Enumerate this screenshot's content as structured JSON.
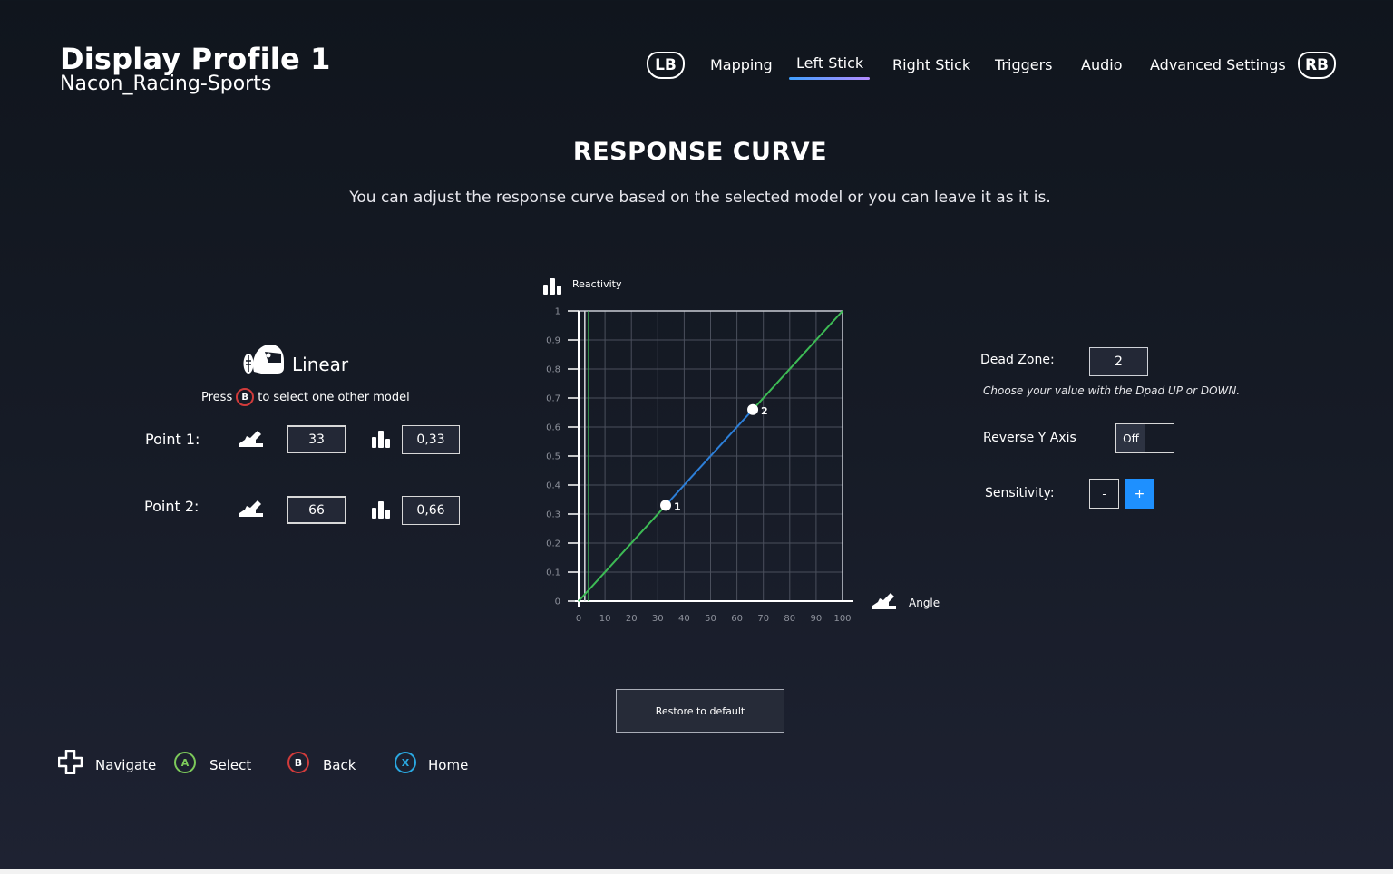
{
  "header": {
    "profile_title": "Display Profile 1",
    "profile_subtitle": "Nacon_Racing-Sports",
    "lb_label": "LB",
    "rb_label": "RB",
    "tabs": [
      {
        "label": "Mapping",
        "active": false
      },
      {
        "label": "Left Stick",
        "active": true
      },
      {
        "label": "Right Stick",
        "active": false
      },
      {
        "label": "Triggers",
        "active": false
      },
      {
        "label": "Audio",
        "active": false
      },
      {
        "label": "Advanced Settings",
        "active": false
      }
    ]
  },
  "section": {
    "title": "RESPONSE CURVE",
    "description": "You can adjust the response curve based on the selected model or you can leave it as it is."
  },
  "model": {
    "name": "Linear",
    "hint_prefix": "Press",
    "hint_button": "B",
    "hint_suffix": "to select one other model"
  },
  "points": [
    {
      "label": "Point 1:",
      "angle": "33",
      "reactivity": "0,33"
    },
    {
      "label": "Point 2:",
      "angle": "66",
      "reactivity": "0,66"
    }
  ],
  "settings": {
    "dead_zone_label": "Dead Zone:",
    "dead_zone_value": "2",
    "dpad_hint": "Choose your value with the Dpad UP or DOWN.",
    "reverse_label": "Reverse Y Axis",
    "reverse_value": "Off",
    "sensitivity_label": "Sensitivity:",
    "minus_label": "-",
    "plus_label": "+"
  },
  "restore_label": "Restore to default",
  "footer": {
    "navigate": "Navigate",
    "select_btn": "A",
    "select": "Select",
    "back_btn": "B",
    "back": "Back",
    "home_btn": "X",
    "home": "Home"
  },
  "colors": {
    "accent_blue": "#1e90ff",
    "curve_green": "#3dbb55",
    "curve_blue": "#2d7fd8",
    "button_a": "#7cc95a",
    "button_b": "#d13b3b",
    "button_x": "#2aa7e0"
  },
  "chart_data": {
    "type": "line",
    "ylabel": "Reactivity",
    "xlabel": "Angle",
    "x_ticks": [
      "0",
      "10",
      "20",
      "30",
      "40",
      "50",
      "60",
      "70",
      "80",
      "90",
      "100"
    ],
    "y_ticks": [
      "0",
      "0.1",
      "0.2",
      "0.3",
      "0.4",
      "0.5",
      "0.6",
      "0.7",
      "0.8",
      "0.9",
      "1"
    ],
    "xlim": [
      0,
      100
    ],
    "ylim": [
      0,
      1
    ],
    "grid": true,
    "dead_zone": 2,
    "curve": [
      [
        0,
        0
      ],
      [
        33,
        0.33
      ],
      [
        66,
        0.66
      ],
      [
        100,
        1
      ]
    ],
    "control_points": [
      {
        "label": "1",
        "x": 33,
        "y": 0.33
      },
      {
        "label": "2",
        "x": 66,
        "y": 0.66
      }
    ]
  }
}
